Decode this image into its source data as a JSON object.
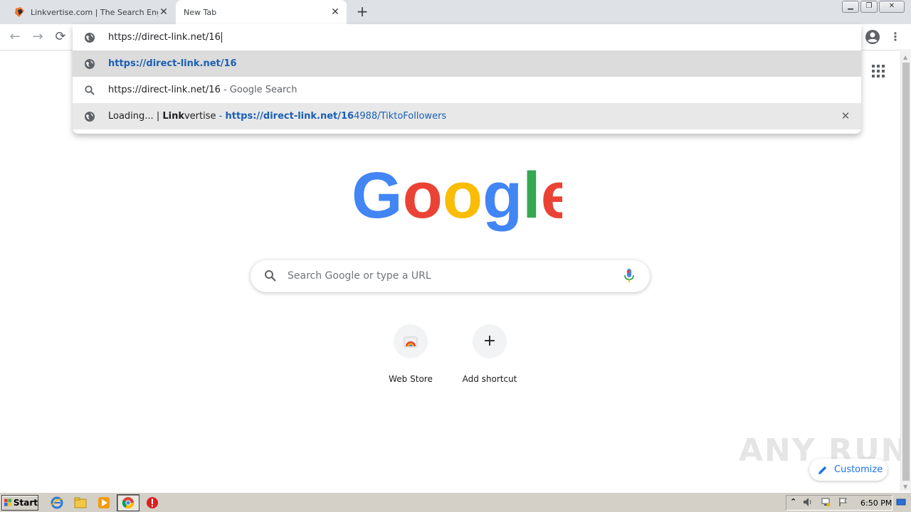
{
  "tabs": [
    {
      "title": "Linkvertise.com | The Search Engine",
      "active": false
    },
    {
      "title": "New Tab",
      "active": true
    }
  ],
  "omnibox": {
    "typed_text": "https://direct-link.net/16",
    "suggestions": [
      {
        "url": "https://direct-link.net/16"
      },
      {
        "query": "https://direct-link.net/16",
        "suffix": " - Google Search"
      },
      {
        "title_prefix": "Loading... | ",
        "title_bold": "Link",
        "title_rest": "vertise",
        "separator": " - ",
        "url_bold": "https://direct-link.net/16",
        "url_rest": "4988/TiktoFollowers"
      }
    ]
  },
  "search": {
    "placeholder": "Search Google or type a URL"
  },
  "shortcuts": [
    {
      "label": "Web Store"
    },
    {
      "label": "Add shortcut"
    }
  ],
  "customize_label": "Customize",
  "watermark": "ANY RUN",
  "taskbar": {
    "start_label": "Start",
    "clock": "6:50 PM"
  },
  "icons": {
    "tab_favicon": "linkvertise-icon",
    "suggestion_page": "globe-icon",
    "suggestion_search": "search-icon",
    "mic": "mic-icon",
    "apps": "apps-grid-icon"
  },
  "colors": {
    "link_blue": "#1a5fb4",
    "google_blue": "#4285f4",
    "google_red": "#ea4335",
    "google_yellow": "#fbbc05",
    "google_green": "#34a853"
  }
}
